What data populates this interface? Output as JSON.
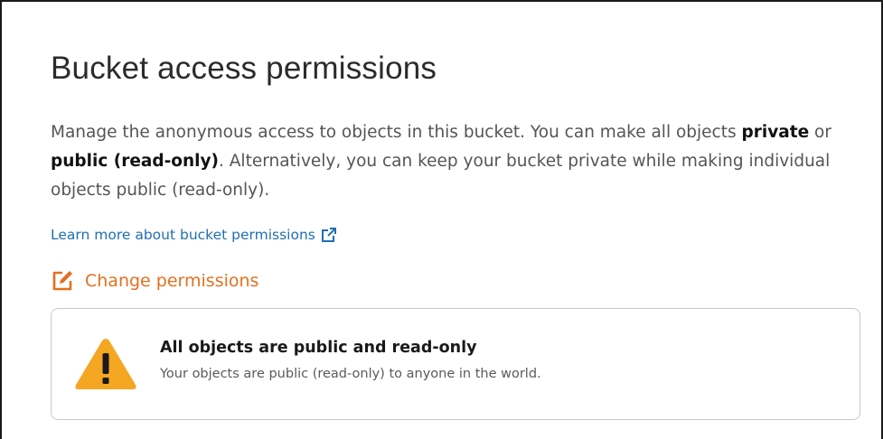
{
  "panel": {
    "title": "Bucket access permissions",
    "description": {
      "part1": "Manage the anonymous access to objects in this bucket. You can make all objects ",
      "private": "private",
      "or": " or ",
      "public": "public (read-only)",
      "part2": ". Alternatively, you can keep your bucket private while making individual objects public (read-only)."
    },
    "learn_link": {
      "label": "Learn more about bucket permissions",
      "icon": "external-link-icon"
    },
    "change_permissions": {
      "label": "Change permissions",
      "icon": "edit-icon",
      "color": "#e2701f"
    },
    "status": {
      "icon": "warning-icon",
      "icon_color": "#f5a623",
      "title": "All objects are public and read-only",
      "subtitle": "Your objects are public (read-only) to anyone in the world."
    }
  }
}
